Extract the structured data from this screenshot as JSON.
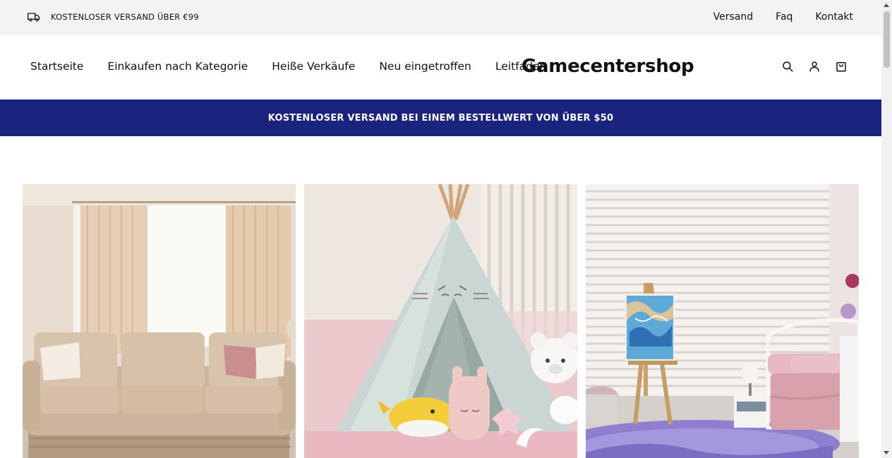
{
  "announcement": {
    "icon": "truck-icon",
    "text": "KOSTENLOSER VERSAND ÜBER €99",
    "links": [
      {
        "label": "Versand"
      },
      {
        "label": "Faq"
      },
      {
        "label": "Kontakt"
      }
    ]
  },
  "header": {
    "nav": [
      {
        "label": "Startseite"
      },
      {
        "label": "Einkaufen nach Kategorie"
      },
      {
        "label": "Heiße Verkäufe"
      },
      {
        "label": "Neu eingetroffen"
      },
      {
        "label": "Leitfaden"
      }
    ],
    "logo": "Gamecentershop",
    "icons": [
      "search-icon",
      "account-icon",
      "cart-icon"
    ]
  },
  "promo": {
    "text": "KOSTENLOSER VERSAND BEI EINEM BESTELLWERT VON ÜBER $50",
    "background": "#1a237e"
  },
  "collections": [
    {
      "image": "living-room-sofa-image"
    },
    {
      "image": "kids-teepee-tent-image"
    },
    {
      "image": "girls-bedroom-easel-image"
    }
  ]
}
